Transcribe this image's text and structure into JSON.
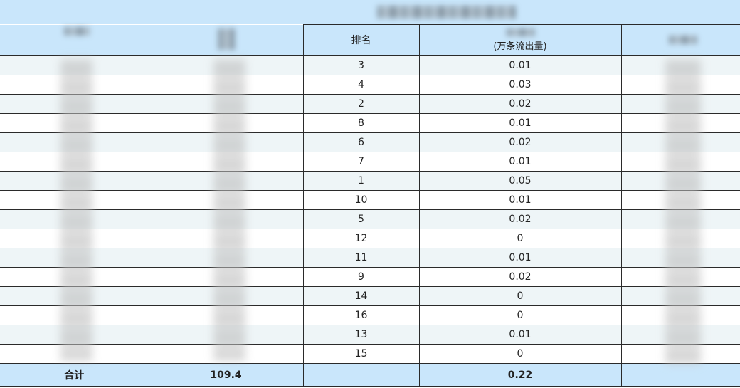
{
  "table": {
    "headers": {
      "rank": "排名",
      "value_unit": "(万条流出量)"
    },
    "rows": [
      {
        "rank": "3",
        "value": "0.01"
      },
      {
        "rank": "4",
        "value": "0.03"
      },
      {
        "rank": "2",
        "value": "0.02"
      },
      {
        "rank": "8",
        "value": "0.01"
      },
      {
        "rank": "6",
        "value": "0.02"
      },
      {
        "rank": "7",
        "value": "0.01"
      },
      {
        "rank": "1",
        "value": "0.05"
      },
      {
        "rank": "10",
        "value": "0.01"
      },
      {
        "rank": "5",
        "value": "0.02"
      },
      {
        "rank": "12",
        "value": "0"
      },
      {
        "rank": "11",
        "value": "0.01"
      },
      {
        "rank": "9",
        "value": "0.02"
      },
      {
        "rank": "14",
        "value": "0"
      },
      {
        "rank": "16",
        "value": "0"
      },
      {
        "rank": "13",
        "value": "0.01"
      },
      {
        "rank": "15",
        "value": "0"
      }
    ],
    "total": {
      "label": "合计",
      "col2": "109.4",
      "value": "0.22"
    }
  },
  "colors": {
    "header_bg": "#c9e6fb",
    "row_alt_bg": "#eef5f7",
    "border": "#2a2a2a"
  }
}
